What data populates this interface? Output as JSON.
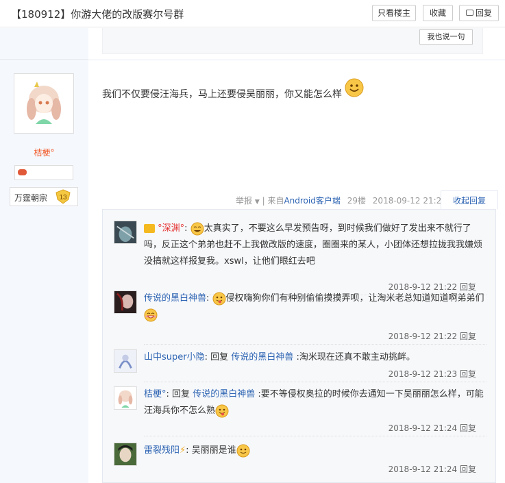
{
  "header": {
    "title": "【180912】你游大佬的改版赛尔号群",
    "buttons": [
      "只看楼主",
      "收藏",
      "回复"
    ]
  },
  "prev_post": {
    "say_button": "我也说一句"
  },
  "author": {
    "name": "桔梗°",
    "level_name": "万霆朝宗",
    "level_num": "13"
  },
  "post": {
    "content": "我们不仅要侵汪海兵，马上还要侵吴丽丽，你又能怎么样",
    "report": "举报",
    "from_prefix": "| 来自",
    "client": "Android客户端",
    "floor": "29楼",
    "datetime": "2018-09-12 21:20",
    "collapse_label": "收起回复"
  },
  "replies": [
    {
      "nick": "°深渊°",
      "colon": ":",
      "text": "太真实了，不要这么早发预告呀，到时候我们做好了发出来不就行了吗，反正这个弟弟也赶不上我做改版的速度，圈圈来的某人，小团体还想拉拢我我嫌烦没搞就这样报复我。xswl，让他们眼红去吧",
      "time": "2018-9-12 21:22",
      "reply": "回复"
    },
    {
      "nick": "传说的黑白神兽",
      "colon": ":",
      "text": "侵权嗨狗你们有种别偷偷摸摸弄呗，让淘米老总知道知道啊弟弟们",
      "time": "2018-9-12 21:22",
      "reply": "回复"
    },
    {
      "nick": "山中super小隐",
      "colon": ":",
      "reply_word": "回复",
      "target": "传说的黑白神兽",
      "text": ":淘米现在还真不敢主动挑衅。",
      "time": "2018-9-12 21:23",
      "reply": "回复"
    },
    {
      "nick": "桔梗°",
      "colon": ":",
      "reply_word": "回复",
      "target": "传说的黑白神兽",
      "text": ":要不等侵权奥拉的时候你去通知一下吴丽丽怎么样，可能汪海兵你不怎么熟",
      "time": "2018-9-12 21:24",
      "reply": "回复"
    },
    {
      "nick": "雷裂残阳",
      "colon": ":",
      "text": "吴丽丽是谁",
      "time": "2018-9-12 21:24",
      "reply": "回复"
    }
  ],
  "colors": {
    "link": "#2d64b3",
    "author": "#f25a29",
    "red_nick": "#e53333"
  }
}
